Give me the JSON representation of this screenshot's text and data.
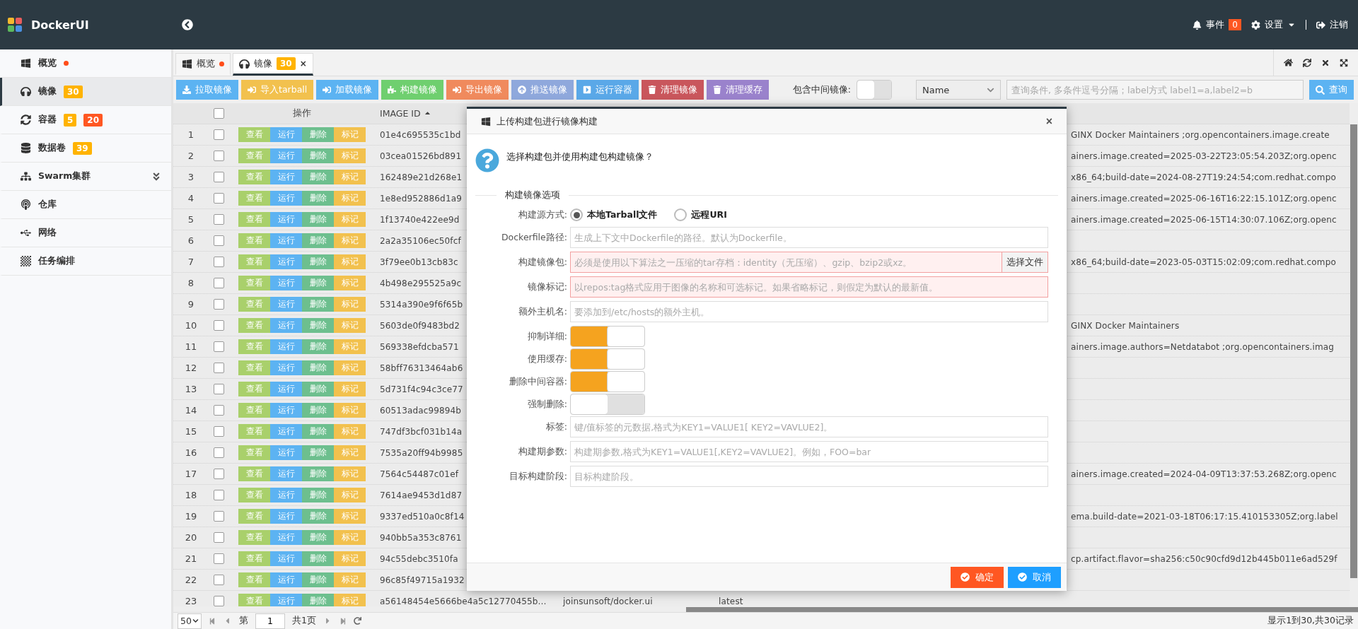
{
  "brand": {
    "name": "DockerUI"
  },
  "header": {
    "events": {
      "label": "事件",
      "count": "0"
    },
    "settings": {
      "label": "设置"
    },
    "logout": {
      "label": "注销"
    }
  },
  "sidebar": {
    "items": [
      {
        "kind": "windows",
        "label": "概览",
        "dot": true,
        "selected": false
      },
      {
        "kind": "headphones",
        "label": "镜像",
        "dot": false,
        "selected": true,
        "badges": [
          {
            "text": "30",
            "color": "#ffb300"
          }
        ]
      },
      {
        "kind": "refresh",
        "label": "容器",
        "dot": false,
        "selected": false,
        "badges": [
          {
            "text": "5",
            "color": "#ffb300"
          },
          {
            "text": "20",
            "color": "#ff5722"
          }
        ]
      },
      {
        "kind": "database",
        "label": "数据卷",
        "dot": false,
        "selected": false,
        "badges": [
          {
            "text": "39",
            "color": "#ffb300"
          }
        ]
      },
      {
        "kind": "sitemap",
        "label": "Swarm集群",
        "dot": false,
        "selected": false,
        "expandable": true
      },
      {
        "kind": "podcast",
        "label": "仓库",
        "dot": false,
        "selected": false
      },
      {
        "kind": "usb",
        "label": "网络",
        "dot": false,
        "selected": false
      },
      {
        "kind": "board",
        "label": "任务编排",
        "dot": false,
        "selected": false
      }
    ]
  },
  "tabs": [
    {
      "kind": "windows",
      "label": "概览",
      "dot": true,
      "selected": false
    },
    {
      "kind": "headphones",
      "label": "镜像",
      "dot": false,
      "badge": "30",
      "close": "×",
      "selected": true
    }
  ],
  "toolbar": {
    "buttons": [
      {
        "kind": "download",
        "label": "拉取镜像",
        "color": "#5cb3f2"
      },
      {
        "kind": "import",
        "label": "导入tarball",
        "color": "#f2c14e"
      },
      {
        "kind": "import",
        "label": "加载镜像",
        "color": "#5cb3f2"
      },
      {
        "kind": "puzzle",
        "label": "构建镜像",
        "color": "#6fcf6f"
      },
      {
        "kind": "import",
        "label": "导出镜像",
        "color": "#f08a5d"
      },
      {
        "kind": "upload",
        "label": "推送镜像",
        "color": "#8fa8dc"
      },
      {
        "kind": "play",
        "label": "运行容器",
        "color": "#5aa8e8"
      },
      {
        "kind": "trash",
        "label": "清理镜像",
        "color": "#c9565c"
      },
      {
        "kind": "trash",
        "label": "清理缓存",
        "color": "#9a82cc"
      }
    ],
    "include_intermediate": {
      "label": "包含中间镜像:",
      "on": false
    },
    "search_field": {
      "value": "Name"
    },
    "query": {
      "placeholder": "查询条件, 多条件逗号分隔；label方式 label1=a,label2=b",
      "button": "查询"
    }
  },
  "table": {
    "header_checkbox": {
      "checked": false
    },
    "columns": [
      {
        "label": "操作"
      },
      {
        "label": "IMAGE ID",
        "sort_ascending": true
      }
    ],
    "rows": [
      {
        "index": "1",
        "checked": false,
        "actions": [
          "查看",
          "运行",
          "删除",
          "标记"
        ],
        "image_id": "01e4c695535c1bd",
        "labels": "GINX Docker Maintainers ;org.opencontainers.image.create"
      },
      {
        "index": "2",
        "checked": false,
        "actions": [
          "查看",
          "运行",
          "删除",
          "标记"
        ],
        "image_id": "03cea01526bd891",
        "labels": "ainers.image.created=2025-03-22T23:05:54.203Z;org.openc"
      },
      {
        "index": "3",
        "checked": false,
        "actions": [
          "查看",
          "运行",
          "删除",
          "标记"
        ],
        "image_id": "162489e21d268e1",
        "labels": "x86_64;build-date=2024-08-27T19:24:54;com.redhat.compo"
      },
      {
        "index": "4",
        "checked": false,
        "actions": [
          "查看",
          "运行",
          "删除",
          "标记"
        ],
        "image_id": "1e8ed952886d1a9",
        "labels": "ainers.image.created=2025-06-16T16:22:15.101Z;org.openc"
      },
      {
        "index": "5",
        "checked": false,
        "actions": [
          "查看",
          "运行",
          "删除",
          "标记"
        ],
        "image_id": "1f13740e422ee9d",
        "labels": "ainers.image.created=2025-06-15T14:30:07.106Z;org.openc"
      },
      {
        "index": "6",
        "checked": false,
        "actions": [
          "查看",
          "运行",
          "删除",
          "标记"
        ],
        "image_id": "2a2a35106ec50fcf"
      },
      {
        "index": "7",
        "checked": false,
        "actions": [
          "查看",
          "运行",
          "删除",
          "标记"
        ],
        "image_id": "3f79ee0b13cb83c",
        "labels": "x86_64;build-date=2023-05-03T15:02:09;com.redhat.compo"
      },
      {
        "index": "8",
        "checked": false,
        "actions": [
          "查看",
          "运行",
          "删除",
          "标记"
        ],
        "image_id": "4b498e295525a9c"
      },
      {
        "index": "9",
        "checked": false,
        "actions": [
          "查看",
          "运行",
          "删除",
          "标记"
        ],
        "image_id": "5314a390e9f6f65b"
      },
      {
        "index": "10",
        "checked": false,
        "actions": [
          "查看",
          "运行",
          "删除",
          "标记"
        ],
        "image_id": "5603de0f9483bd2",
        "labels": "GINX Docker Maintainers"
      },
      {
        "index": "11",
        "checked": false,
        "actions": [
          "查看",
          "运行",
          "删除",
          "标记"
        ],
        "image_id": "569338efdcba571",
        "labels": "ainers.image.authors=Netdatabot ;org.opencontainers.imag"
      },
      {
        "index": "12",
        "checked": false,
        "actions": [
          "查看",
          "运行",
          "删除",
          "标记"
        ],
        "image_id": "58bff76313464ab6"
      },
      {
        "index": "13",
        "checked": false,
        "actions": [
          "查看",
          "运行",
          "删除",
          "标记"
        ],
        "image_id": "5d731f4c94c3ce77"
      },
      {
        "index": "14",
        "checked": false,
        "actions": [
          "查看",
          "运行",
          "删除",
          "标记"
        ],
        "image_id": "60513adac99894b"
      },
      {
        "index": "15",
        "checked": false,
        "actions": [
          "查看",
          "运行",
          "删除",
          "标记"
        ],
        "image_id": "747df3bcf031b14a"
      },
      {
        "index": "16",
        "checked": false,
        "actions": [
          "查看",
          "运行",
          "删除",
          "标记"
        ],
        "image_id": "7535a20ff94b9985"
      },
      {
        "index": "17",
        "checked": false,
        "actions": [
          "查看",
          "运行",
          "删除",
          "标记"
        ],
        "image_id": "7564c54487c01ef",
        "labels": "ainers.image.created=2024-04-09T13:37:53.268Z;org.openc"
      },
      {
        "index": "18",
        "checked": false,
        "actions": [
          "查看",
          "运行",
          "删除",
          "标记"
        ],
        "image_id": "7614ae9453d1d87"
      },
      {
        "index": "19",
        "checked": false,
        "actions": [
          "查看",
          "运行",
          "删除",
          "标记"
        ],
        "image_id": "9337ed510a0c8f14",
        "labels": "ema.build-date=2021-03-18T06:17:15.410153305Z;org.label"
      },
      {
        "index": "20",
        "checked": false,
        "actions": [
          "查看",
          "运行",
          "删除",
          "标记"
        ],
        "image_id": "940bb5a353c8761"
      },
      {
        "index": "21",
        "checked": false,
        "actions": [
          "查看",
          "运行",
          "删除",
          "标记"
        ],
        "image_id": "94c55debc3510fa",
        "labels": "cp.artifact.flavor=sha256:c50c90cfd9d12b445b011e6ad529f"
      },
      {
        "index": "22",
        "checked": false,
        "actions": [
          "查看",
          "运行",
          "删除",
          "标记"
        ],
        "image_id": "96c85f49715a1932"
      },
      {
        "index": "23",
        "checked": false,
        "actions": [
          "查看",
          "运行",
          "删除",
          "标记"
        ],
        "image_id": "a56148454e5666be4a5c12770455b…",
        "repository": "joinsunsoft/docker.ui",
        "tag": "latest"
      }
    ]
  },
  "pager": {
    "page_size": "50",
    "page_prefix": "第",
    "page": "1",
    "page_total": "共1页",
    "summary": "显示1到30,共30记录"
  },
  "dialog": {
    "title": "上传构建包进行镜像构建",
    "close": "×",
    "prompt": "选择构建包并使用构建包构建镜像？",
    "section": "构建镜像选项",
    "fields": [
      {
        "kind": "radio",
        "label": "构建源方式:",
        "options": [
          {
            "label": "本地Tarball文件",
            "selected": true
          },
          {
            "label": "远程URI",
            "selected": false
          }
        ]
      },
      {
        "kind": "text",
        "label": "Dockerfile路径:",
        "placeholder": "生成上下文中Dockerfile的路径。默认为Dockerfile。",
        "invalid": false
      },
      {
        "kind": "file",
        "label": "构建镜像包:",
        "placeholder": "必须是使用以下算法之一压缩的tar存档：identity（无压缩）、gzip、bzip2或xz。",
        "button": "选择文件",
        "invalid": true
      },
      {
        "kind": "text",
        "label": "镜像标记:",
        "placeholder": "以repos:tag格式应用于图像的名称和可选标记。如果省略标记，则假定为默认的最新值。",
        "invalid": true
      },
      {
        "kind": "text",
        "label": "额外主机名:",
        "placeholder": "要添加到/etc/hosts的额外主机。",
        "invalid": false
      },
      {
        "kind": "switch",
        "label": "抑制详细:",
        "on": true
      },
      {
        "kind": "switch",
        "label": "使用缓存:",
        "on": true
      },
      {
        "kind": "switch",
        "label": "删除中间容器:",
        "on": true
      },
      {
        "kind": "switch",
        "label": "强制删除:",
        "on": false
      },
      {
        "kind": "text",
        "label": "标签:",
        "placeholder": "键/值标签的元数据,格式为KEY1=VALUE1[ KEY2=VAVLUE2]。",
        "invalid": false
      },
      {
        "kind": "text",
        "label": "构建期参数:",
        "placeholder": "构建期参数,格式为KEY1=VALUE1[,KEY2=VAVLUE2]。例如，FOO=bar",
        "invalid": false
      },
      {
        "kind": "text",
        "label": "目标构建阶段:",
        "placeholder": "目标构建阶段。",
        "invalid": false
      }
    ],
    "buttons": [
      {
        "kind": "confirm",
        "label": "确定"
      },
      {
        "kind": "cancel",
        "label": "取消"
      }
    ]
  }
}
